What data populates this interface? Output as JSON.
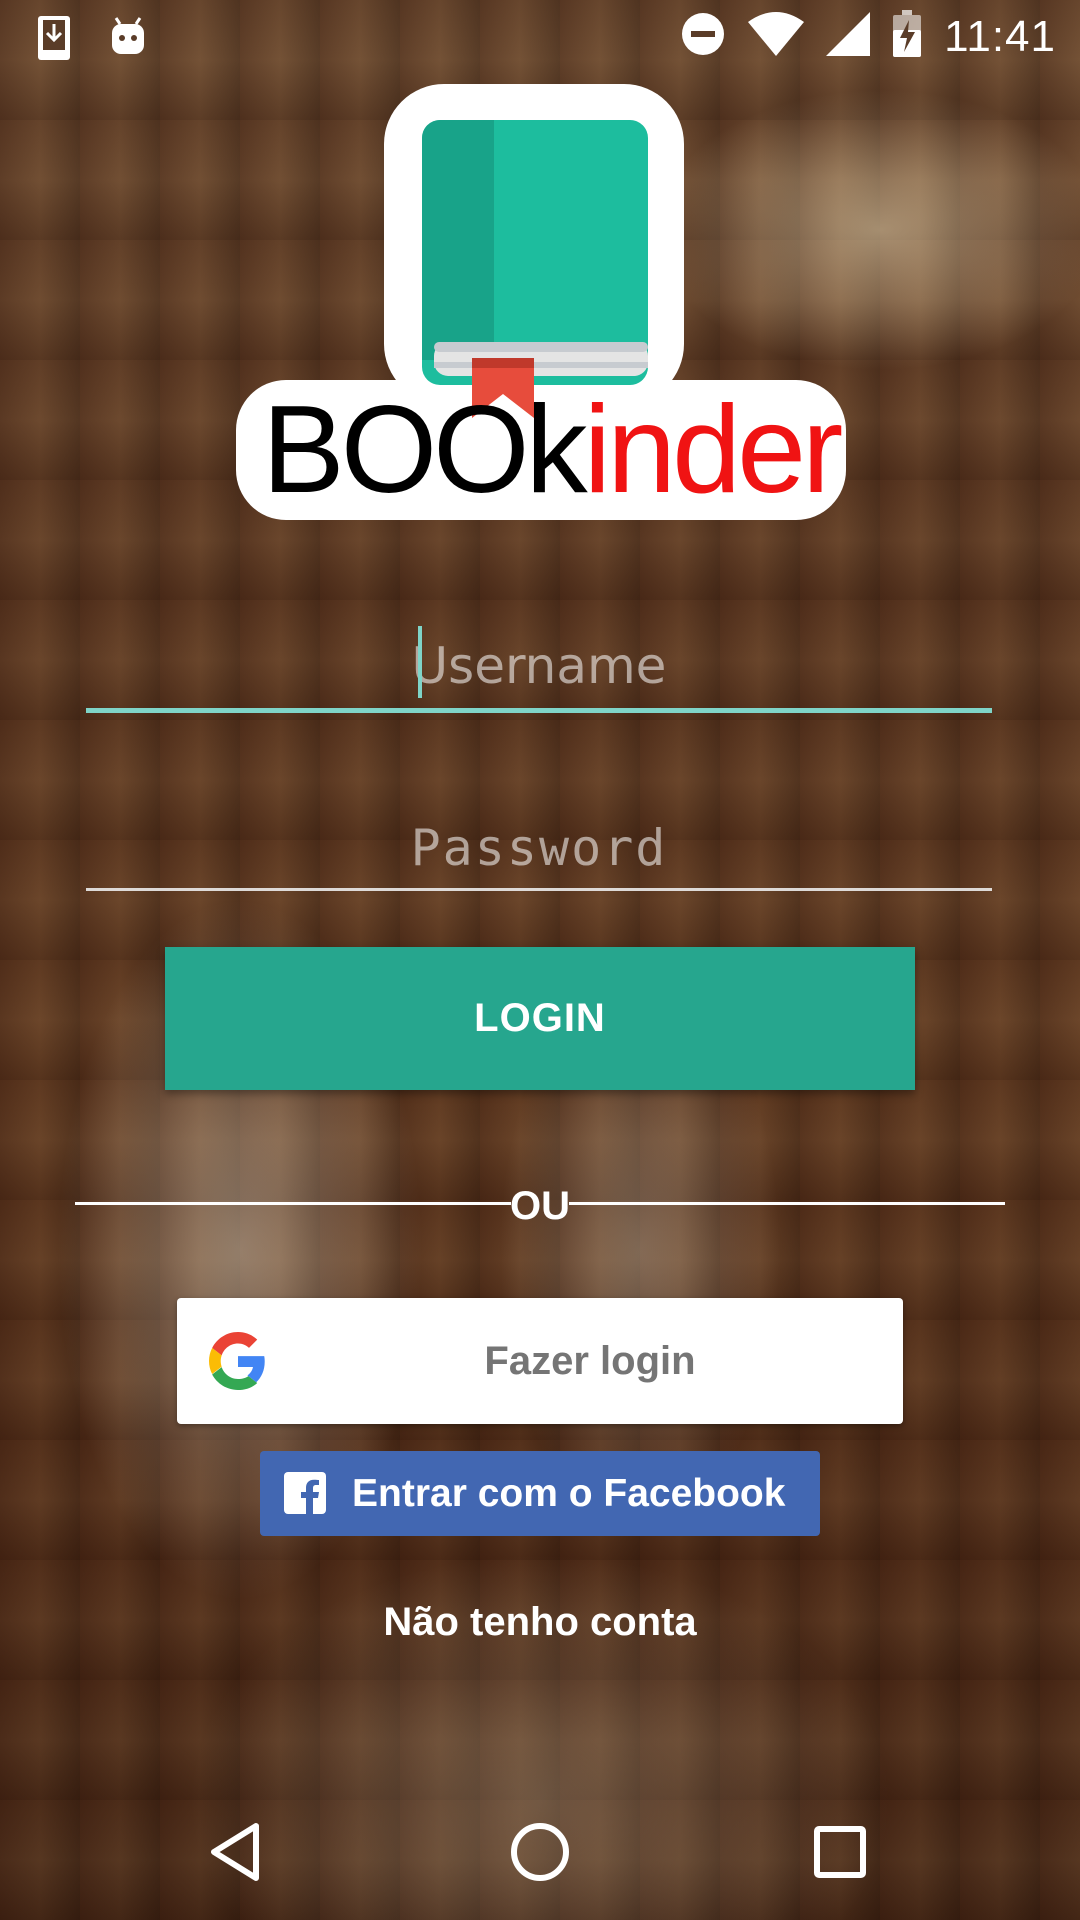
{
  "status_bar": {
    "time": "11:41",
    "left_icons": [
      "download-icon",
      "android-icon"
    ],
    "right_icons": [
      "do-not-disturb-icon",
      "wifi-icon",
      "cell-signal-icon",
      "battery-charging-icon"
    ]
  },
  "logo": {
    "text_black": "BOOk",
    "text_red": "inder",
    "icon": "book-icon"
  },
  "form": {
    "username_placeholder": "Username",
    "password_placeholder": "Password",
    "login_label": "LOGIN"
  },
  "divider": {
    "label": "OU"
  },
  "social": {
    "google_label": "Fazer login",
    "facebook_label": "Entrar com o Facebook"
  },
  "no_account_label": "Não tenho conta",
  "colors": {
    "accent": "#26a68e",
    "input_focus": "#7fd4c8",
    "facebook": "#4267b2",
    "brand_red": "#f01313"
  },
  "nav_bar": {
    "icons": [
      "back-icon",
      "home-icon",
      "recents-icon"
    ]
  }
}
